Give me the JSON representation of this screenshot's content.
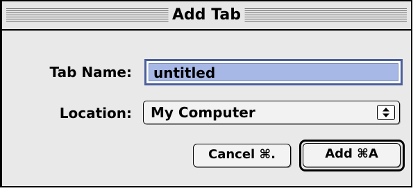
{
  "dialog": {
    "title": "Add Tab"
  },
  "form": {
    "tab_name_label": "Tab Name:",
    "tab_name_value": "untitled",
    "location_label": "Location:",
    "location_value": "My Computer"
  },
  "buttons": {
    "cancel_label": "Cancel ⌘.",
    "add_label": "Add ⌘A"
  },
  "colors": {
    "selection": "#a8b8e6",
    "focus_ring": "#4a5f9b",
    "window_bg": "#e9e9e9"
  },
  "icons": {
    "popup": "up-down-arrows-icon"
  }
}
